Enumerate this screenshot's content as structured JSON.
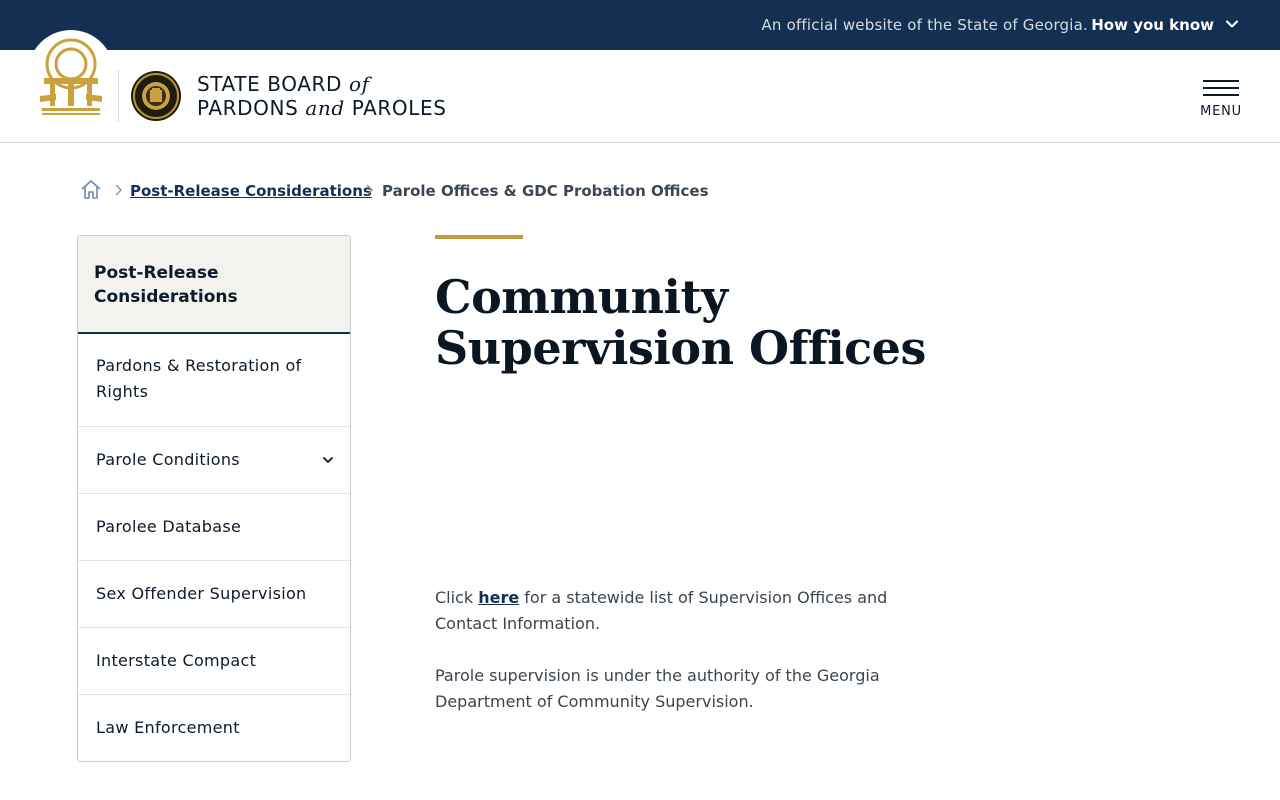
{
  "banner": {
    "official_text": "An official website of the State of Georgia.",
    "how_you_know": "How you know"
  },
  "header": {
    "org_name_line1_a": "STATE BOARD ",
    "org_name_line1_b": "of",
    "org_name_line2_a": "PARDONS ",
    "org_name_line2_b": "and",
    "org_name_line2_c": " PAROLES",
    "menu_label": "MENU"
  },
  "breadcrumb": {
    "parent": "Post-Release Considerations",
    "current": "Parole Offices & GDC Probation Offices"
  },
  "sidebar": {
    "heading": "Post-Release Considerations",
    "items": [
      {
        "label": "Pardons & Restoration of Rights",
        "has_submenu": false
      },
      {
        "label": "Parole Conditions",
        "has_submenu": true
      },
      {
        "label": "Parolee Database",
        "has_submenu": false
      },
      {
        "label": "Sex Offender Supervision",
        "has_submenu": false
      },
      {
        "label": "Interstate Compact",
        "has_submenu": false
      },
      {
        "label": "Law Enforcement",
        "has_submenu": false
      }
    ]
  },
  "main": {
    "title": "Community Supervision Offices",
    "para1_before": "Click ",
    "para1_link": "here",
    "para1_after": " for a statewide list of Supervision Offices and Contact Information.",
    "para2": "Parole supervision is under the authority of the Georgia Department of Community Supervision."
  },
  "colors": {
    "navy": "#132f52",
    "gold": "#c19b3d",
    "sidebar_head_bg": "#f3f2ee"
  },
  "icons": [
    "chevron-down-icon",
    "georgia-arch-logo",
    "board-seal",
    "hamburger-icon",
    "home-icon",
    "chevron-right-icon"
  ]
}
